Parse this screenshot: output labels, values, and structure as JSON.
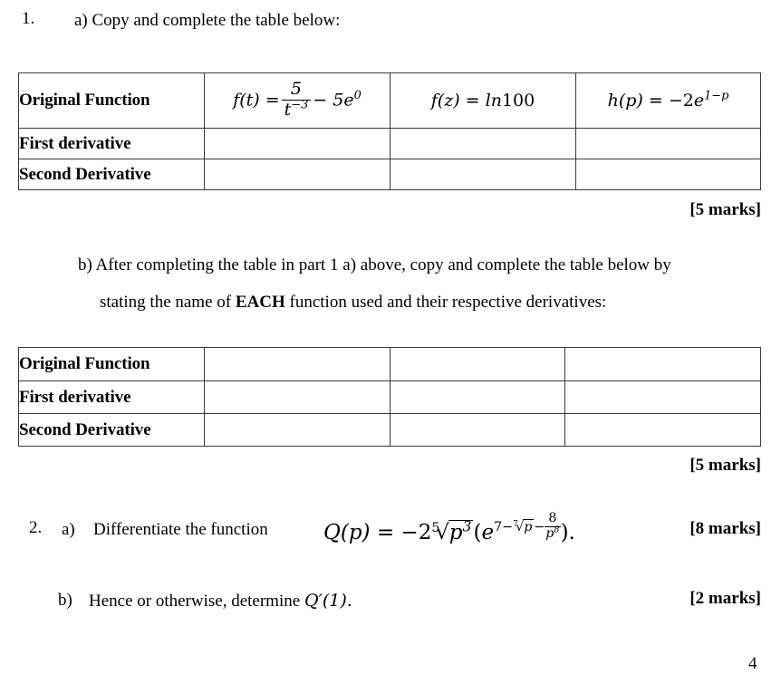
{
  "document": {
    "page_number": "4"
  },
  "question1": {
    "number": "1.",
    "part_a_label": "a) Copy and complete the table below:",
    "part_a_marks": "[5 marks]",
    "part_b_line1": "b) After completing the table in part 1 a) above, copy and complete the table below by",
    "part_b_line2_pre": "stating the name of ",
    "part_b_line2_bold": "EACH",
    "part_b_line2_post": " function used and their respective derivatives:",
    "part_b_marks": "[5 marks]",
    "table_a": {
      "row_labels": [
        "Original Function",
        "First derivative",
        "Second Derivative"
      ],
      "functions": [
        {
          "plain": "f(t) = 5/t^(-3) - 5e^0",
          "lhs": "f(t) =",
          "numerator": "5",
          "denominator_base": "t",
          "denominator_exp": "−3",
          "tail_op": "− 5",
          "tail_base": "e",
          "tail_exp": "0"
        },
        {
          "plain": "f(z) = ln100",
          "lhs": "f(z) =",
          "fn": "ln",
          "arg": "100"
        },
        {
          "plain": "h(p) = −2e^(1−p)",
          "lhs": "h(p) =",
          "coef": "−2",
          "base": "e",
          "exp": "1−p"
        }
      ],
      "empty_cells": [
        "",
        "",
        "",
        "",
        "",
        ""
      ]
    },
    "table_b": {
      "row_labels": [
        "Original Function",
        "First derivative",
        "Second Derivative"
      ],
      "empty_cells": [
        "",
        "",
        "",
        "",
        "",
        "",
        "",
        "",
        ""
      ]
    }
  },
  "question2": {
    "number": "2.",
    "part_a_letter": "a)",
    "part_a_text": "Differentiate the function",
    "part_a_marks": "[8 marks]",
    "part_a_formula": {
      "plain": "Q(p) = −2⁵√(p³)(e^(7−⁷√p−8/p⁸)).",
      "lhs": "Q(p) =",
      "coef": "−2",
      "root_index": "5",
      "root_radicand_base": "p",
      "root_radicand_exp": "3",
      "open_paren": "(",
      "base": "e",
      "exp_first": "7−",
      "exp_root_index": "7",
      "exp_root_radicand": "p",
      "exp_minus": "−",
      "exp_frac_num": "8",
      "exp_frac_den_base": "p",
      "exp_frac_den_exp": "8",
      "close": ")."
    },
    "part_b_letter": "b)",
    "part_b_text_pre": "Hence or otherwise, determine ",
    "part_b_math": "Q′(1).",
    "part_b_marks": "[2 marks]"
  }
}
